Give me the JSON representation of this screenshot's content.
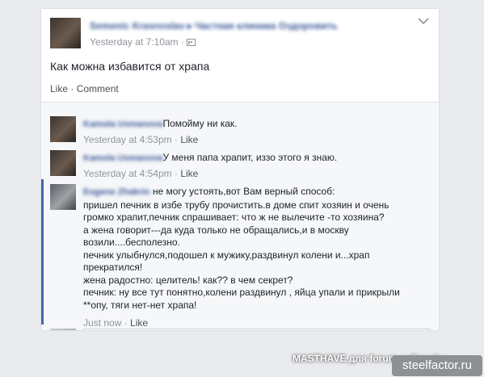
{
  "post": {
    "author": "Semenic Krasnoslav ▸ Частная клиника Оздоровить",
    "time": "Yesterday at 7:10am",
    "audience_icon": "calendar-icon",
    "text": "Как можна избавится от храпа",
    "actions": {
      "like": "Like",
      "comment": "Comment",
      "separator": "·"
    }
  },
  "comments": [
    {
      "name": "Kamola Usmanova",
      "text": "Помойму ни как.",
      "time": "Yesterday at 4:53pm",
      "like": "Like"
    },
    {
      "name": "Kamola Usmanova",
      "text": "У меня папа храпит, иззо этого я знаю.",
      "time": "Yesterday at 4:54pm",
      "like": "Like"
    },
    {
      "name": "Eugene Zhakrin",
      "lines": [
        "не могу устоять,вот Вам верный способ:",
        "пришел печник в избе трубу прочистить.в доме спит хозяин и очень",
        "громко храпит,печник спрашивает: что ж не вылечите -то хозяина?",
        "а жена говорит---да куда только не обращались,и в москву",
        "возили....бесполезно.",
        "печник улыбнулся,подошел к мужику,раздвинул колени и...храп",
        "прекратился!",
        "жена радостно: целитель! как?? в чем секрет?",
        "печник: ну все тут понятно,колени раздвинул , яйца упали и прикрыли",
        "**опу, тяги нет-нет храпа!"
      ],
      "time": "Just now",
      "like": "Like"
    }
  ],
  "watermark": {
    "text1": "MASTHAVE для forum.onliner.by",
    "text2": "steelfactor.ru"
  }
}
